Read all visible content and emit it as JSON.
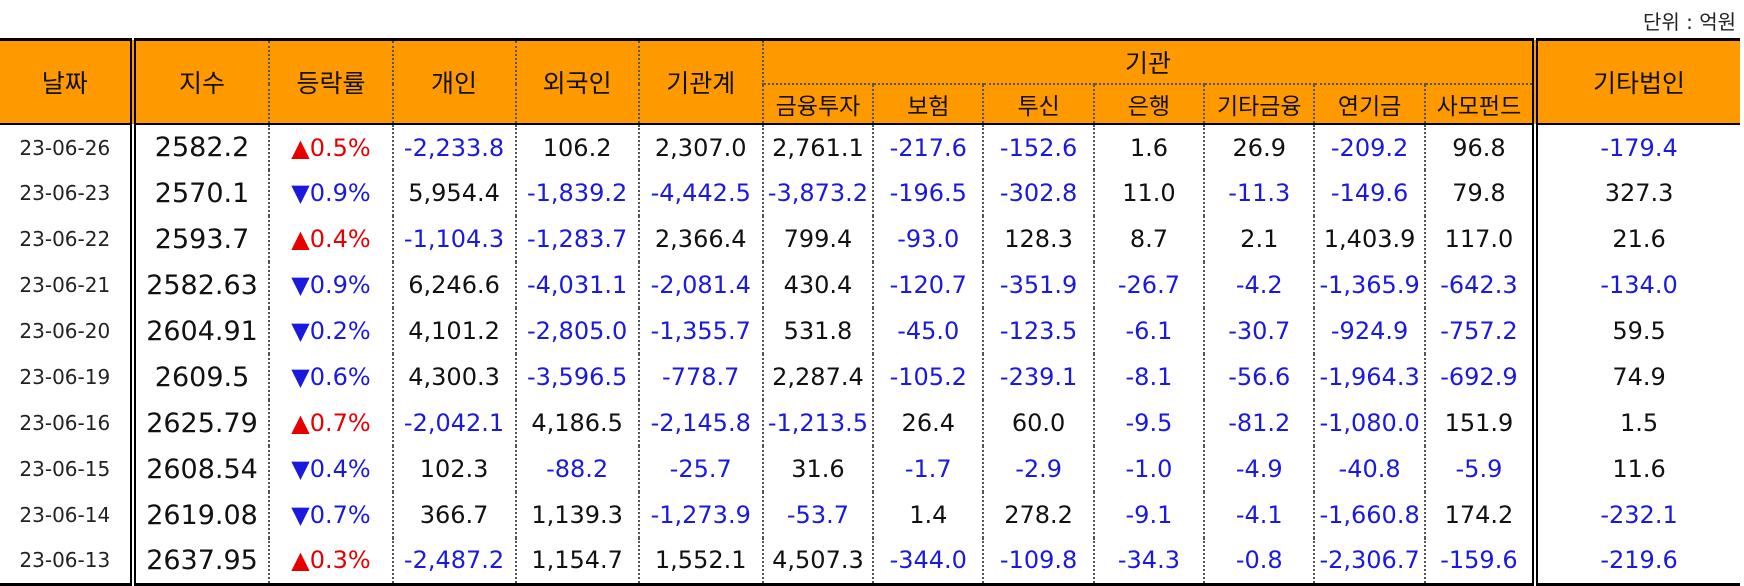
{
  "unit_label": "단위 : 억원",
  "headers": {
    "date": "날짜",
    "index": "지수",
    "change": "등락률",
    "individual": "개인",
    "foreign": "외국인",
    "inst_total": "기관계",
    "institution": "기관",
    "other_corp": "기타법인",
    "inst_sub": [
      "금융투자",
      "보험",
      "투신",
      "은행",
      "기타금융",
      "연기금",
      "사모펀드"
    ]
  },
  "colors": {
    "header_bg": "#ff9900",
    "negative": "#1a1adf",
    "up_arrow": "#e60000",
    "down_arrow": "#1a1adf"
  },
  "rows": [
    {
      "date": "23-06-26",
      "index": "2582.2",
      "arrow": "▲",
      "dir": "up",
      "change": "0.5%",
      "individual": "-2,233.8",
      "foreign": "106.2",
      "inst_total": "2,307.0",
      "fin_invest": "2,761.1",
      "insurance": "-217.6",
      "trust": "-152.6",
      "bank": "1.6",
      "other_fin": "26.9",
      "pension": "-209.2",
      "pef": "96.8",
      "other_corp": "-179.4"
    },
    {
      "date": "23-06-23",
      "index": "2570.1",
      "arrow": "▼",
      "dir": "down",
      "change": "0.9%",
      "individual": "5,954.4",
      "foreign": "-1,839.2",
      "inst_total": "-4,442.5",
      "fin_invest": "-3,873.2",
      "insurance": "-196.5",
      "trust": "-302.8",
      "bank": "11.0",
      "other_fin": "-11.3",
      "pension": "-149.6",
      "pef": "79.8",
      "other_corp": "327.3"
    },
    {
      "date": "23-06-22",
      "index": "2593.7",
      "arrow": "▲",
      "dir": "up",
      "change": "0.4%",
      "individual": "-1,104.3",
      "foreign": "-1,283.7",
      "inst_total": "2,366.4",
      "fin_invest": "799.4",
      "insurance": "-93.0",
      "trust": "128.3",
      "bank": "8.7",
      "other_fin": "2.1",
      "pension": "1,403.9",
      "pef": "117.0",
      "other_corp": "21.6"
    },
    {
      "date": "23-06-21",
      "index": "2582.63",
      "arrow": "▼",
      "dir": "down",
      "change": "0.9%",
      "individual": "6,246.6",
      "foreign": "-4,031.1",
      "inst_total": "-2,081.4",
      "fin_invest": "430.4",
      "insurance": "-120.7",
      "trust": "-351.9",
      "bank": "-26.7",
      "other_fin": "-4.2",
      "pension": "-1,365.9",
      "pef": "-642.3",
      "other_corp": "-134.0"
    },
    {
      "date": "23-06-20",
      "index": "2604.91",
      "arrow": "▼",
      "dir": "down",
      "change": "0.2%",
      "individual": "4,101.2",
      "foreign": "-2,805.0",
      "inst_total": "-1,355.7",
      "fin_invest": "531.8",
      "insurance": "-45.0",
      "trust": "-123.5",
      "bank": "-6.1",
      "other_fin": "-30.7",
      "pension": "-924.9",
      "pef": "-757.2",
      "other_corp": "59.5"
    },
    {
      "date": "23-06-19",
      "index": "2609.5",
      "arrow": "▼",
      "dir": "down",
      "change": "0.6%",
      "individual": "4,300.3",
      "foreign": "-3,596.5",
      "inst_total": "-778.7",
      "fin_invest": "2,287.4",
      "insurance": "-105.2",
      "trust": "-239.1",
      "bank": "-8.1",
      "other_fin": "-56.6",
      "pension": "-1,964.3",
      "pef": "-692.9",
      "other_corp": "74.9"
    },
    {
      "date": "23-06-16",
      "index": "2625.79",
      "arrow": "▲",
      "dir": "up",
      "change": "0.7%",
      "individual": "-2,042.1",
      "foreign": "4,186.5",
      "inst_total": "-2,145.8",
      "fin_invest": "-1,213.5",
      "insurance": "26.4",
      "trust": "60.0",
      "bank": "-9.5",
      "other_fin": "-81.2",
      "pension": "-1,080.0",
      "pef": "151.9",
      "other_corp": "1.5"
    },
    {
      "date": "23-06-15",
      "index": "2608.54",
      "arrow": "▼",
      "dir": "down",
      "change": "0.4%",
      "individual": "102.3",
      "foreign": "-88.2",
      "inst_total": "-25.7",
      "fin_invest": "31.6",
      "insurance": "-1.7",
      "trust": "-2.9",
      "bank": "-1.0",
      "other_fin": "-4.9",
      "pension": "-40.8",
      "pef": "-5.9",
      "other_corp": "11.6"
    },
    {
      "date": "23-06-14",
      "index": "2619.08",
      "arrow": "▼",
      "dir": "down",
      "change": "0.7%",
      "individual": "366.7",
      "foreign": "1,139.3",
      "inst_total": "-1,273.9",
      "fin_invest": "-53.7",
      "insurance": "1.4",
      "trust": "278.2",
      "bank": "-9.1",
      "other_fin": "-4.1",
      "pension": "-1,660.8",
      "pef": "174.2",
      "other_corp": "-232.1"
    },
    {
      "date": "23-06-13",
      "index": "2637.95",
      "arrow": "▲",
      "dir": "up",
      "change": "0.3%",
      "individual": "-2,487.2",
      "foreign": "1,154.7",
      "inst_total": "1,552.1",
      "fin_invest": "4,507.3",
      "insurance": "-344.0",
      "trust": "-109.8",
      "bank": "-34.3",
      "other_fin": "-0.8",
      "pension": "-2,306.7",
      "pef": "-159.6",
      "other_corp": "-219.6"
    }
  ]
}
